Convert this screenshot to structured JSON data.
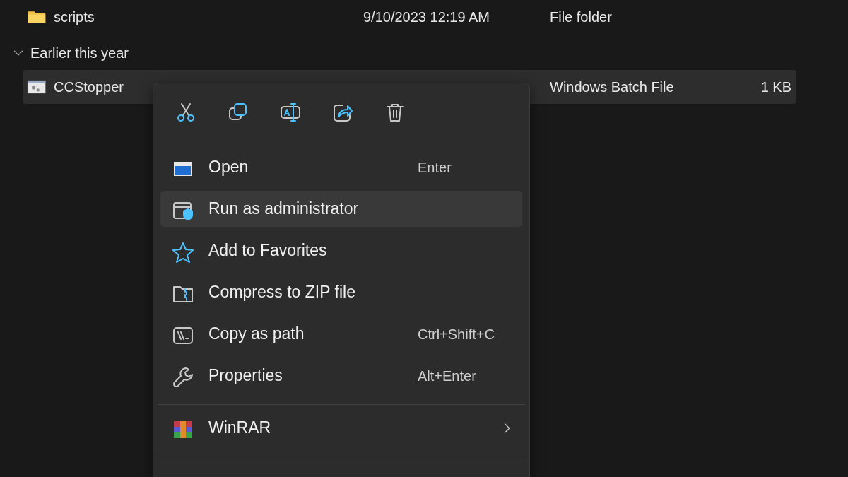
{
  "rows": [
    {
      "kind": "folder",
      "name": "scripts",
      "date": "9/10/2023 12:19 AM",
      "type": "File folder",
      "selected": false
    },
    {
      "kind": "group",
      "label": "Earlier this year",
      "expanded": true
    },
    {
      "kind": "file",
      "name": "CCStopper",
      "type": "Windows Batch File",
      "size": "1 KB",
      "selected": true
    }
  ],
  "context_menu": {
    "sections": [
      [
        {
          "label": "Open",
          "shortcut": "Enter",
          "selected": false
        },
        {
          "label": "Run as administrator",
          "selected": true
        },
        {
          "label": "Add to Favorites",
          "selected": false
        },
        {
          "label": "Compress to ZIP file",
          "selected": false
        },
        {
          "label": "Copy as path",
          "shortcut": "Ctrl+Shift+C",
          "selected": false
        },
        {
          "label": "Properties",
          "shortcut": "Alt+Enter",
          "selected": false
        }
      ],
      [
        {
          "label": "WinRAR",
          "submenu": true,
          "selected": false
        }
      ]
    ]
  }
}
